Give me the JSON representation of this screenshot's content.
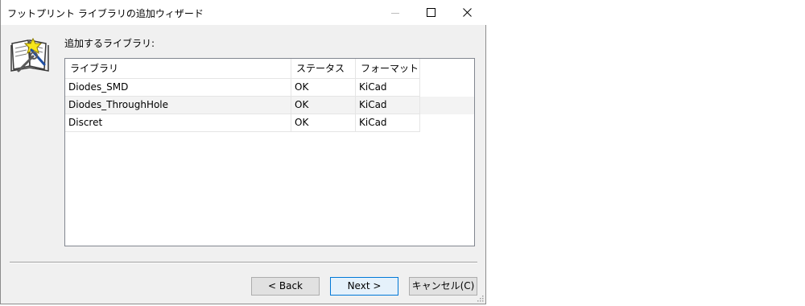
{
  "window": {
    "title": "フットプリント ライブラリの追加ウィザード"
  },
  "page": {
    "section_label": "追加するライブラリ:"
  },
  "table": {
    "columns": [
      "ライブラリ",
      "ステータス",
      "フォーマット"
    ],
    "rows": [
      [
        "Diodes_SMD",
        "OK",
        "KiCad"
      ],
      [
        "Diodes_ThroughHole",
        "OK",
        "KiCad"
      ],
      [
        "Discret",
        "OK",
        "KiCad"
      ]
    ]
  },
  "buttons": {
    "back_label": "< Back",
    "next_label": "Next >",
    "cancel_label": "キャンセル(C)"
  },
  "colors": {
    "window_bg": "#f0f0f0",
    "accent": "#0078d7"
  },
  "icons": {
    "wizard": "book-wand-wrench-icon",
    "minimize": "minimize-icon",
    "maximize": "maximize-icon",
    "close": "close-icon"
  }
}
